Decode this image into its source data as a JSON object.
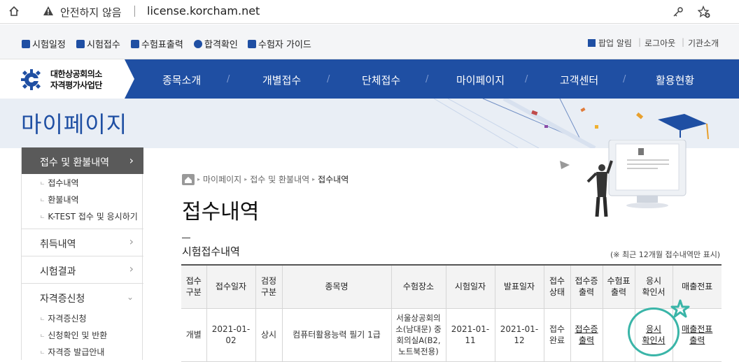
{
  "browser": {
    "security_label": "안전하지 않음",
    "url": "license.korcham.net"
  },
  "utility": {
    "left": [
      {
        "label": "시험일정"
      },
      {
        "label": "시험접수"
      },
      {
        "label": "수험표출력"
      },
      {
        "label": "합격확인"
      },
      {
        "label": "수험자 가이드"
      }
    ],
    "right": [
      "팝업 알림",
      "로그아웃",
      "기관소개"
    ]
  },
  "logo": {
    "line1": "대한상공회의소",
    "line2": "자격평가사업단"
  },
  "gnb": [
    "종목소개",
    "개별접수",
    "단체접수",
    "마이페이지",
    "고객센터",
    "활용현황"
  ],
  "hero": {
    "title": "마이페이지"
  },
  "sidebar": {
    "active": "접수 및 환불내역",
    "active_subs": [
      "접수내역",
      "환불내역",
      "K-TEST 접수 및 응시하기"
    ],
    "categories": [
      "취득내역",
      "시험결과",
      "자격증신청"
    ],
    "cert_subs": [
      "자격증신청",
      "신청확인 및 반환",
      "자격증 발급안내"
    ]
  },
  "breadcrumb": [
    "마이페이지",
    "접수 및 환불내역",
    "접수내역"
  ],
  "page_title": "접수내역",
  "section": {
    "title": "시험접수내역",
    "note": "(※ 최근 12개월 접수내역만 표시)"
  },
  "table": {
    "headers": [
      "접수\n구분",
      "접수일자",
      "검정\n구분",
      "종목명",
      "수험장소",
      "시험일자",
      "발표일자",
      "접수\n상태",
      "접수증\n출력",
      "수험표\n출력",
      "응시\n확인서",
      "매출전표"
    ],
    "row": {
      "type": "개별",
      "date": "2021-01-02",
      "kind": "상시",
      "subject": "컴퓨터활용능력 필기 1급",
      "place": "서울상공회의소(남대문) 중회의실A(B2,노트북전용)",
      "exam_date": "2021-01-11",
      "result_date": "2021-01-12",
      "status": "접수완료",
      "receipt": "접수증\n출력",
      "ticket": "",
      "confirm": "응시\n확인서",
      "sales": "매출전표\n출력"
    }
  },
  "colors": {
    "brand": "#1f4fa3",
    "annotation": "#3ab5a8"
  }
}
